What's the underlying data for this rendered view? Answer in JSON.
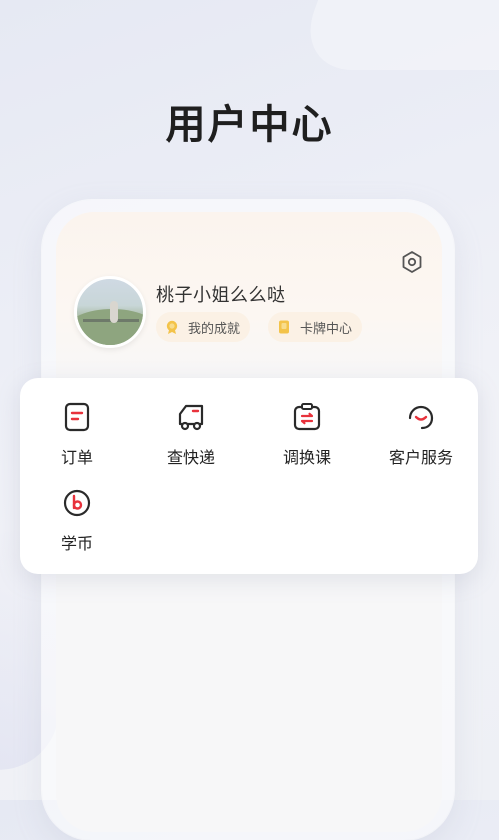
{
  "page": {
    "title": "用户中心"
  },
  "profile": {
    "username": "桃子小姐么么哒",
    "badges": [
      {
        "label": "我的成就",
        "icon": "medal-icon"
      },
      {
        "label": "卡牌中心",
        "icon": "card-icon"
      }
    ],
    "settings_icon": "settings-hexagon-icon"
  },
  "menu": {
    "items": [
      {
        "label": "订单",
        "icon": "order-icon"
      },
      {
        "label": "查快递",
        "icon": "delivery-truck-icon"
      },
      {
        "label": "调换课",
        "icon": "exchange-class-icon"
      },
      {
        "label": "客户服务",
        "icon": "customer-service-icon"
      },
      {
        "label": "学币",
        "icon": "coin-icon"
      }
    ]
  },
  "colors": {
    "accent": "#e8323c",
    "icon_dark": "#2a2a2a",
    "badge_bg": "#fbf1e5",
    "badge_icon": "#f3c34a"
  }
}
